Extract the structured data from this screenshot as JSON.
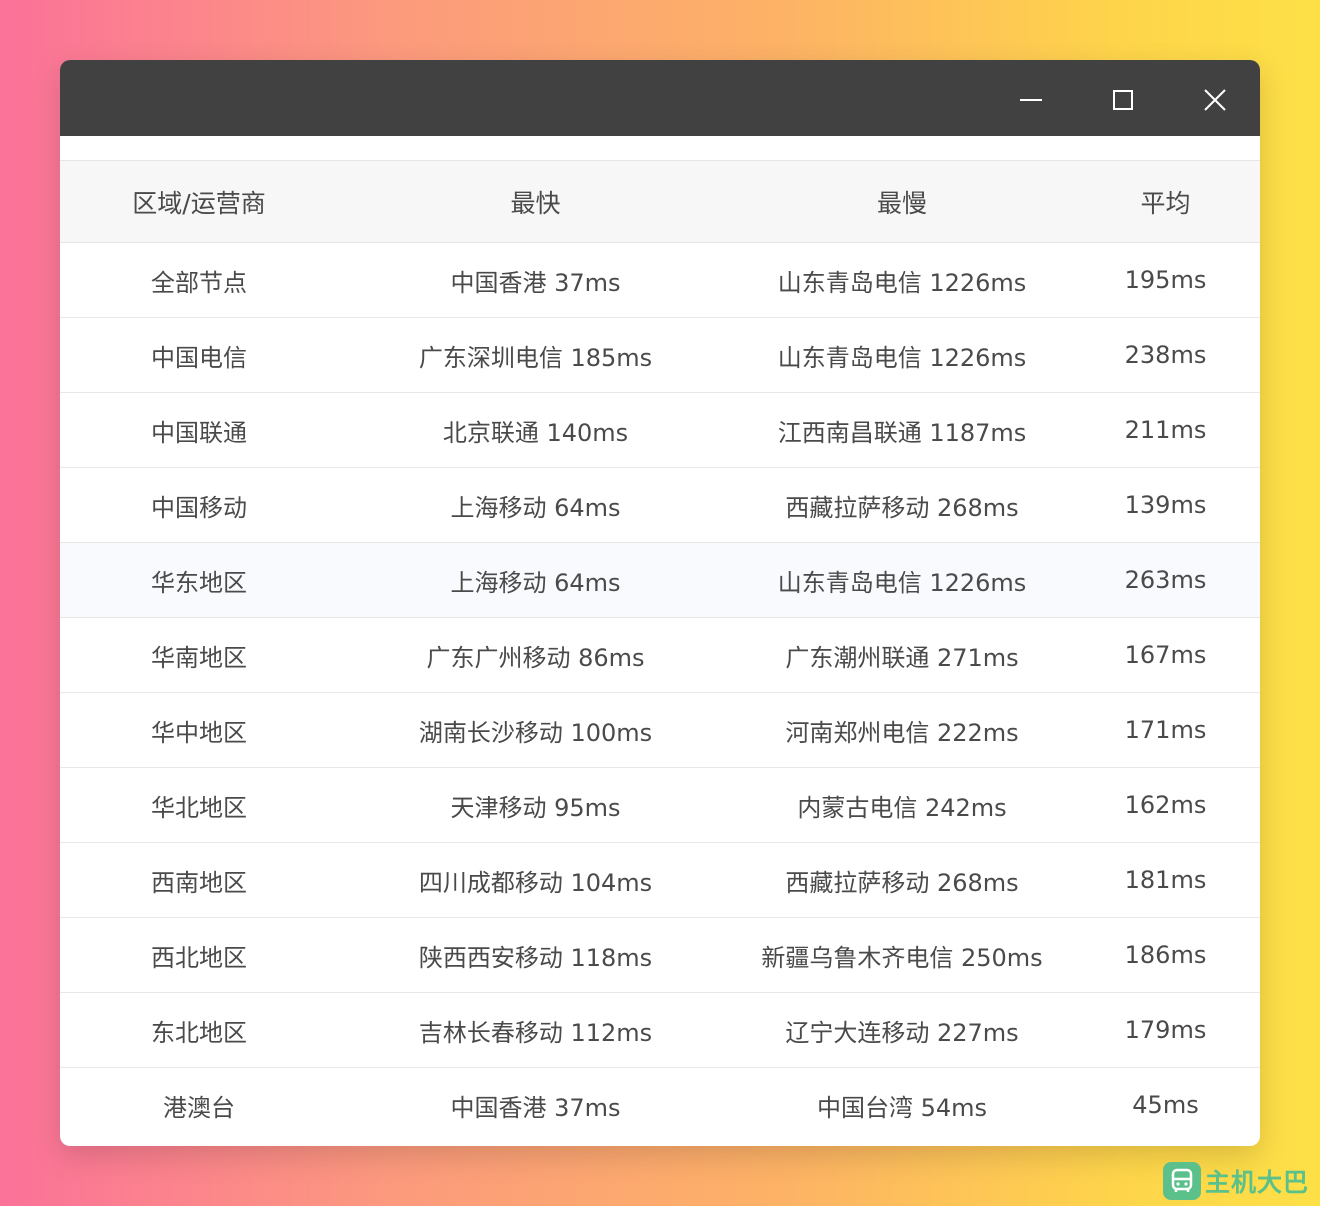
{
  "window": {
    "controls": [
      "minimize-icon",
      "maximize-icon",
      "close-icon"
    ]
  },
  "table": {
    "headers": [
      "区域/运营商",
      "最快",
      "最慢",
      "平均"
    ],
    "rows": [
      [
        "全部节点",
        "中国香港 37ms",
        "山东青岛电信 1226ms",
        "195ms"
      ],
      [
        "中国电信",
        "广东深圳电信 185ms",
        "山东青岛电信 1226ms",
        "238ms"
      ],
      [
        "中国联通",
        "北京联通 140ms",
        "江西南昌联通 1187ms",
        "211ms"
      ],
      [
        "中国移动",
        "上海移动 64ms",
        "西藏拉萨移动 268ms",
        "139ms"
      ],
      [
        "华东地区",
        "上海移动 64ms",
        "山东青岛电信 1226ms",
        "263ms"
      ],
      [
        "华南地区",
        "广东广州移动 86ms",
        "广东潮州联通 271ms",
        "167ms"
      ],
      [
        "华中地区",
        "湖南长沙移动 100ms",
        "河南郑州电信 222ms",
        "171ms"
      ],
      [
        "华北地区",
        "天津移动 95ms",
        "内蒙古电信 242ms",
        "162ms"
      ],
      [
        "西南地区",
        "四川成都移动 104ms",
        "西藏拉萨移动 268ms",
        "181ms"
      ],
      [
        "西北地区",
        "陕西西安移动 118ms",
        "新疆乌鲁木齐电信 250ms",
        "186ms"
      ],
      [
        "东北地区",
        "吉林长春移动 112ms",
        "辽宁大连移动 227ms",
        "179ms"
      ],
      [
        "港澳台",
        "中国香港 37ms",
        "中国台湾 54ms",
        "45ms"
      ]
    ]
  },
  "watermark": {
    "text": "主机大巴",
    "icon": "bus-icon",
    "color": "#5bc08a"
  }
}
